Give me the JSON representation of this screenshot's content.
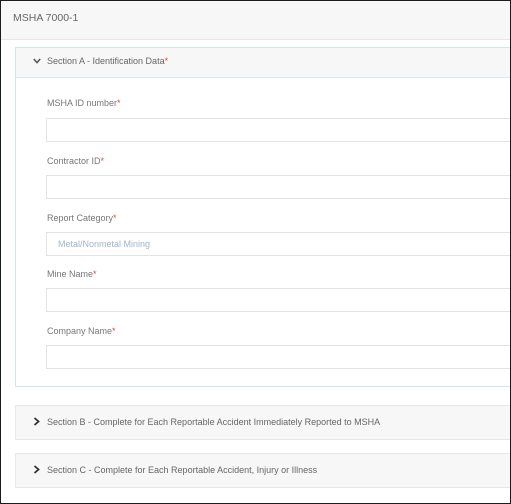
{
  "form": {
    "title": "MSHA 7000-1"
  },
  "sectionA": {
    "title": "Section A - Identification Data",
    "required_mark": "*",
    "fields": [
      {
        "label": "MSHA ID number",
        "value": "",
        "placeholder": ""
      },
      {
        "label": "Contractor ID",
        "value": "",
        "placeholder": ""
      },
      {
        "label": "Report Category",
        "value": "",
        "placeholder": "Metal/Nonmetal Mining"
      },
      {
        "label": "Mine Name",
        "value": "",
        "placeholder": ""
      },
      {
        "label": "Company Name",
        "value": "",
        "placeholder": ""
      }
    ]
  },
  "sectionB": {
    "title": "Section B - Complete for Each Reportable Accident Immediately Reported to MSHA"
  },
  "sectionC": {
    "title": "Section C - Complete for Each Reportable Accident, Injury or Illness"
  },
  "colors": {
    "required": "#e0473f",
    "section_border": "#cfe6ef",
    "placeholder": "#9fb6cd"
  },
  "icons": {
    "expanded": "chevron-down-icon",
    "collapsed": "chevron-right-icon"
  }
}
